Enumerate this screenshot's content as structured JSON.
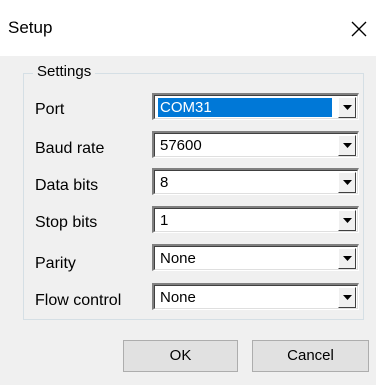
{
  "window": {
    "title": "Setup",
    "close_icon": "close-icon"
  },
  "settings": {
    "group_label": "Settings",
    "rows": [
      {
        "label": "Port",
        "value": "COM31",
        "selected": true
      },
      {
        "label": "Baud rate",
        "value": "57600"
      },
      {
        "label": "Data bits",
        "value": "8"
      },
      {
        "label": "Stop bits",
        "value": "1"
      },
      {
        "label": "Parity",
        "value": "None"
      },
      {
        "label": "Flow control",
        "value": "None"
      }
    ]
  },
  "buttons": {
    "ok": "OK",
    "cancel": "Cancel"
  },
  "colors": {
    "selection": "#0078d7",
    "dialog_bg": "#f0f0f0"
  }
}
